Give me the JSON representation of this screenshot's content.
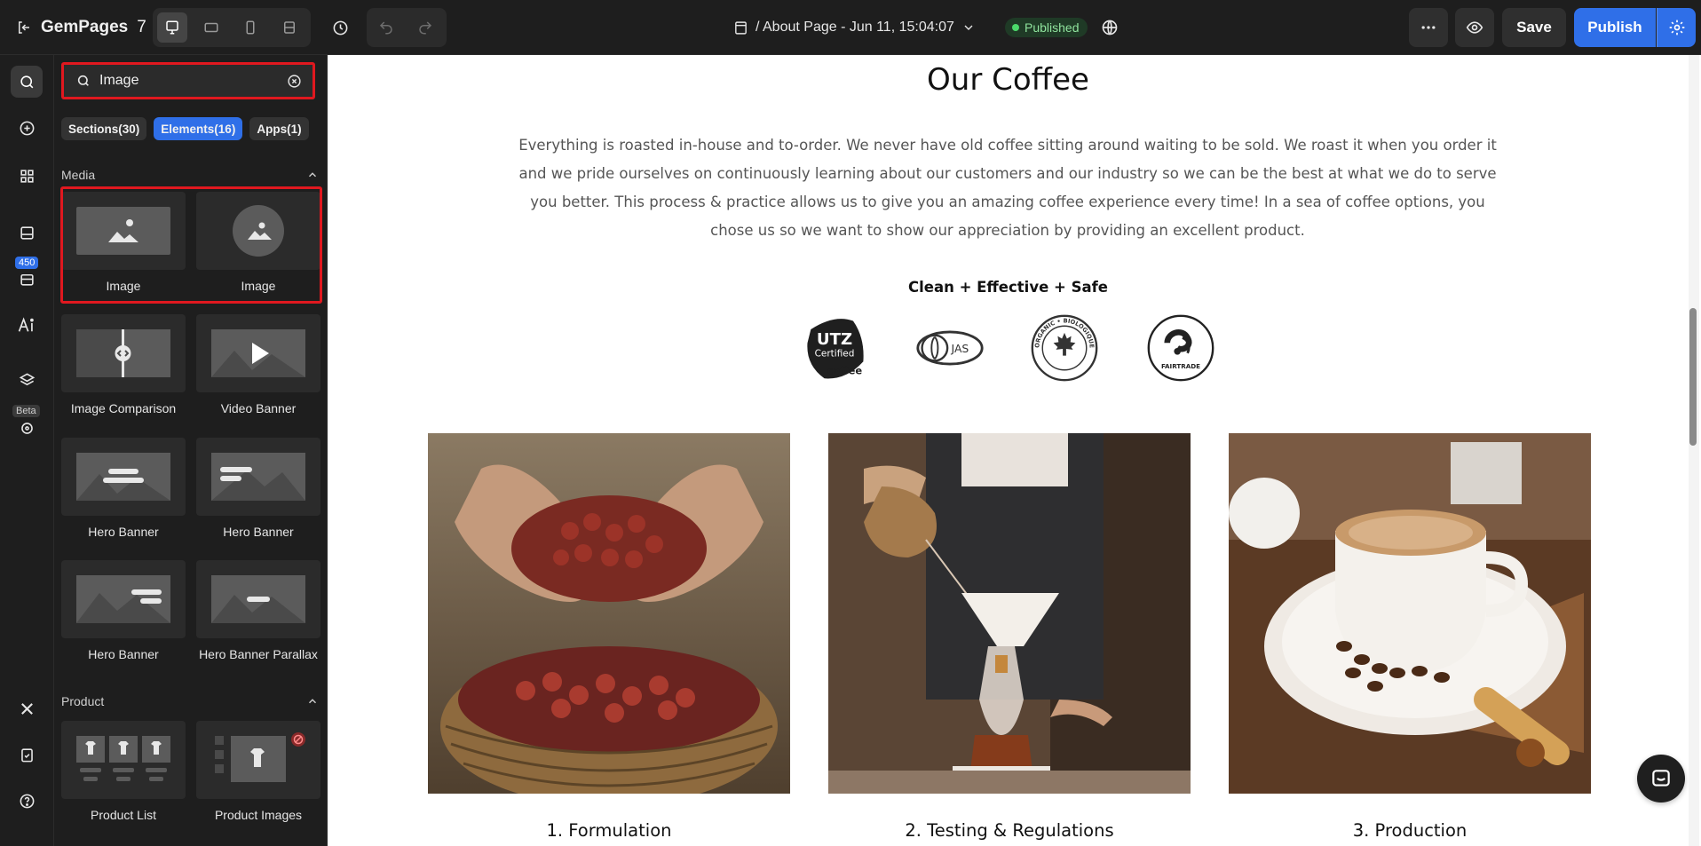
{
  "topbar": {
    "logo_text": "GemPages",
    "logo_version": "7",
    "page_name": "/ About Page - Jun 11, 15:04:07",
    "status": "Published",
    "save_label": "Save",
    "publish_label": "Publish",
    "devices": [
      "desktop-icon",
      "tablet-landscape-icon",
      "mobile-icon",
      "responsive-icon"
    ]
  },
  "rail": {
    "badge": "450",
    "beta": "Beta"
  },
  "panel": {
    "search_value": "Image",
    "search_placeholder": "Search",
    "tabs": [
      {
        "label": "Sections(30)",
        "active": false
      },
      {
        "label": "Elements(16)",
        "active": true
      },
      {
        "label": "Apps(1)",
        "active": false
      }
    ],
    "groups": [
      {
        "title": "Media"
      },
      {
        "title": "Product"
      }
    ],
    "elements": [
      {
        "label": "Image"
      },
      {
        "label": "Image"
      },
      {
        "label": "Image Comparison"
      },
      {
        "label": "Video Banner"
      },
      {
        "label": "Hero Banner"
      },
      {
        "label": "Hero Banner"
      },
      {
        "label": "Hero Banner"
      },
      {
        "label": "Hero Banner Parallax"
      },
      {
        "label": "Product List"
      },
      {
        "label": "Product Images"
      }
    ]
  },
  "canvas": {
    "heading": "Our Coffee",
    "paragraph": "Everything is roasted in-house and to-order. We never have old coffee sitting around waiting to be sold. We roast it when you order it and we pride ourselves on continuously learning about our customers and our industry so we can be the best at what we do to serve you better. This process & practice allows us to give you an amazing coffee experience every time! In a sea of coffee options, you chose us so we want to show our appreciation by providing an excellent product.",
    "certs_title": "Clean + Effective + Safe",
    "certs": [
      {
        "name": "utz-certified-logo",
        "line1": "UTZ",
        "line2": "Certified",
        "line3": "coffee"
      },
      {
        "name": "jas-logo",
        "text": "JAS"
      },
      {
        "name": "canada-organic-logo",
        "text": "ORGANIC • BIOLOGIQUE • CANADA"
      },
      {
        "name": "fairtrade-logo",
        "text": "FAIRTRADE"
      }
    ],
    "steps": [
      {
        "label": "1. Formulation"
      },
      {
        "label": "2. Testing & Regulations"
      },
      {
        "label": "3. Production"
      }
    ]
  },
  "colors": {
    "accent": "#2f6fe8",
    "highlight": "#e0181f",
    "published": "#4bd86a"
  }
}
